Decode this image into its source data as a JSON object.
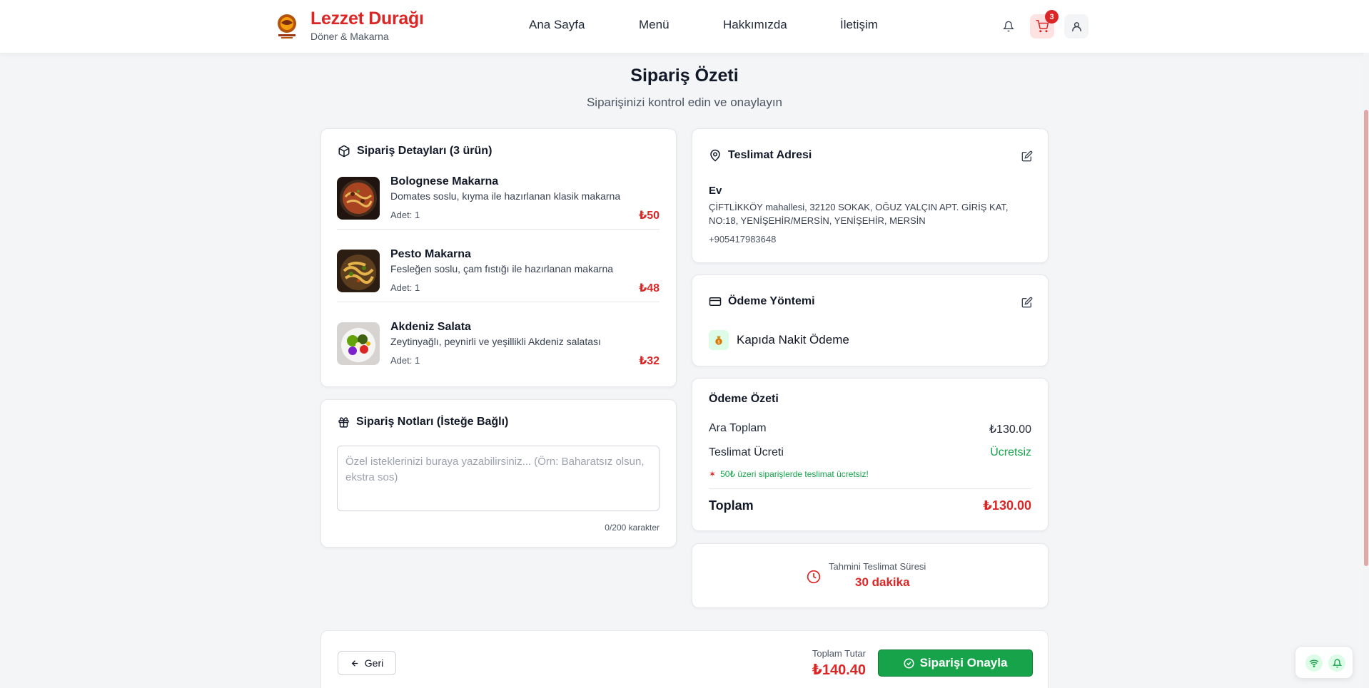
{
  "header": {
    "brand_name": "Lezzet Durağı",
    "brand_sub": "Döner & Makarna",
    "nav": [
      "Ana Sayfa",
      "Menü",
      "Hakkımızda",
      "İletişim"
    ],
    "cart_count": "3"
  },
  "page": {
    "title": "Sipariş Özeti",
    "subtitle": "Siparişinizi kontrol edin ve onaylayın"
  },
  "order_details": {
    "title": "Sipariş Detayları (3 ürün)",
    "items": [
      {
        "name": "Bolognese Makarna",
        "desc": "Domates soslu, kıyma ile hazırlanan klasik makarna",
        "qty": "Adet: 1",
        "price": "₺50"
      },
      {
        "name": "Pesto Makarna",
        "desc": "Fesleğen soslu, çam fıstığı ile hazırlanan makarna",
        "qty": "Adet: 1",
        "price": "₺48"
      },
      {
        "name": "Akdeniz Salata",
        "desc": "Zeytinyağlı, peynirli ve yeşillikli Akdeniz salatası",
        "qty": "Adet: 1",
        "price": "₺32"
      }
    ]
  },
  "notes": {
    "title": "Sipariş Notları (İsteğe Bağlı)",
    "value": "",
    "placeholder": "Özel isteklerinizi buraya yazabilirsiniz... (Örn: Baharatsız olsun, ekstra sos)",
    "char_count": "0/200 karakter"
  },
  "address": {
    "title": "Teslimat Adresi",
    "label": "Ev",
    "line1": "ÇİFTLİKKÖY mahallesi, 32120 SOKAK, OĞUZ YALÇIN APT. GİRİŞ KAT,",
    "line2": "NO:18, YENİŞEHİR/MERSİN, YENİŞEHİR, MERSİN",
    "phone": "+905417983648"
  },
  "payment": {
    "title": "Ödeme Yöntemi",
    "method": "Kapıda Nakit Ödeme"
  },
  "summary": {
    "title": "Ödeme Özeti",
    "subtotal_label": "Ara Toplam",
    "subtotal_value": "₺130.00",
    "delivery_label": "Teslimat Ücreti",
    "delivery_value": "Ücretsiz",
    "promo": "50₺ üzeri siparişlerde teslimat ücretsiz!",
    "total_label": "Toplam",
    "total_value": "₺130.00"
  },
  "delivery_time": {
    "label": "Tahmini Teslimat Süresi",
    "value": "30 dakika"
  },
  "footer": {
    "back_label": "Geri",
    "total_label": "Toplam Tutar",
    "total_value": "₺140.40",
    "confirm_label": "Siparişi Onayla"
  },
  "colors": {
    "accent": "#dc2626",
    "success": "#16a34a"
  }
}
